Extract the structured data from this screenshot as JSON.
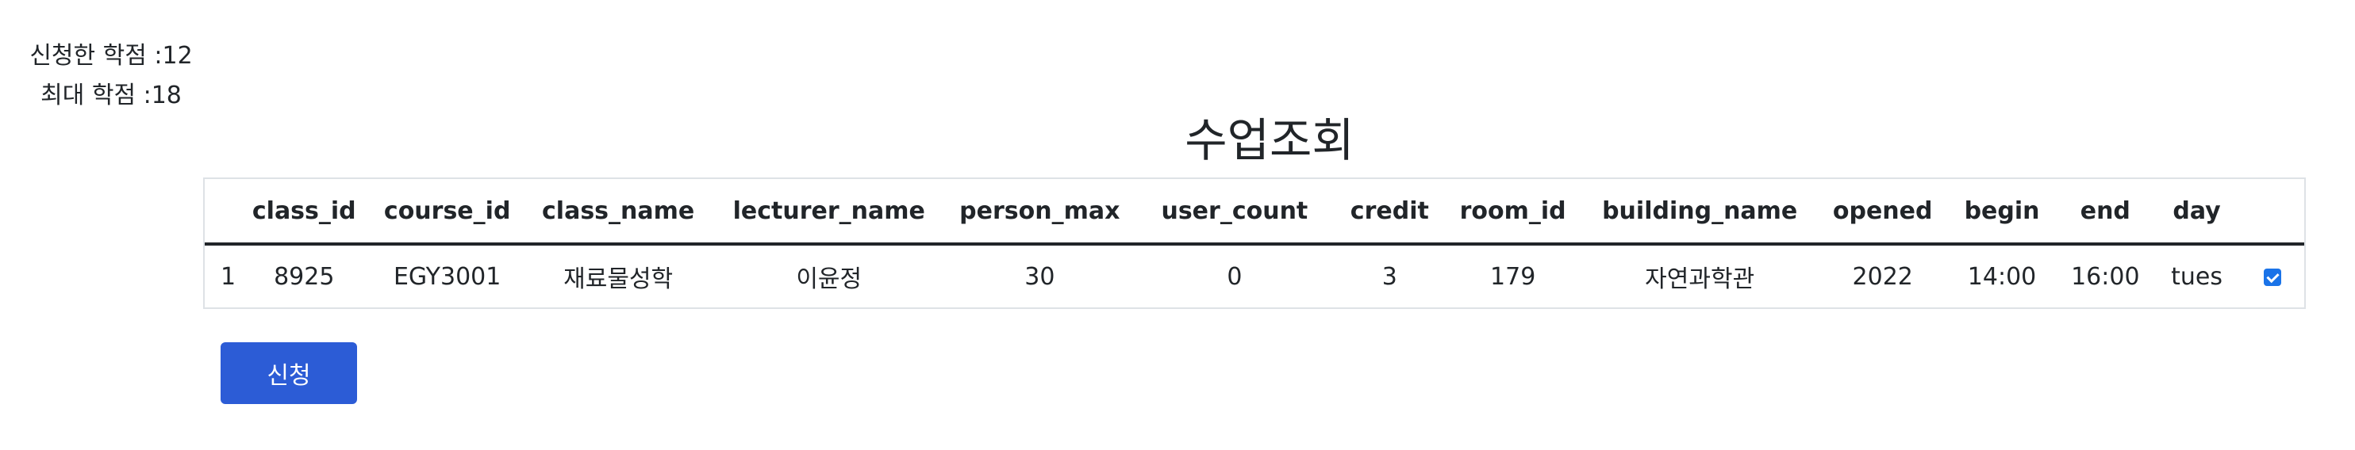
{
  "credit_info": {
    "applied_label": "신청한 학점 :12",
    "max_label": "최대 학점 :18"
  },
  "page_title": "수업조회",
  "table": {
    "columns": [
      "",
      "class_id",
      "course_id",
      "class_name",
      "lecturer_name",
      "person_max",
      "user_count",
      "credit",
      "room_id",
      "building_name",
      "opened",
      "begin",
      "end",
      "day",
      ""
    ],
    "rows": [
      {
        "num": "1",
        "class_id": "8925",
        "course_id": "EGY3001",
        "class_name": "재료물성학",
        "lecturer_name": "이윤정",
        "person_max": "30",
        "user_count": "0",
        "credit": "3",
        "room_id": "179",
        "building_name": "자연과학관",
        "opened": "2022",
        "begin": "14:00",
        "end": "16:00",
        "day": "tues",
        "checked": true
      }
    ]
  },
  "submit_button": {
    "label": "신청"
  },
  "colors": {
    "button_bg": "#2c5cd6",
    "checkbox": "#1a73e8"
  }
}
